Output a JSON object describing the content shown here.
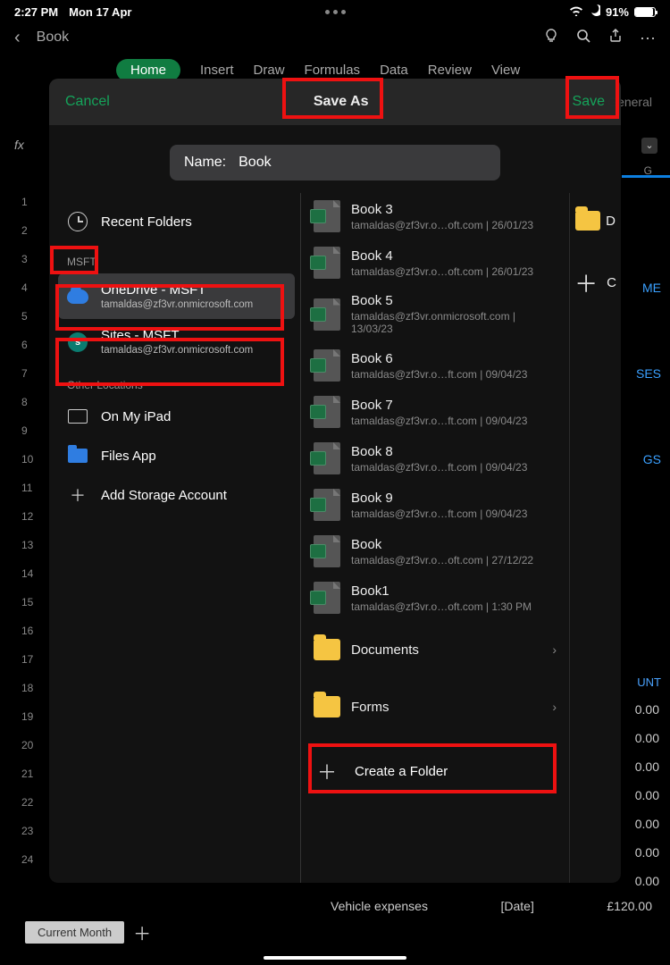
{
  "status": {
    "time": "2:27 PM",
    "date": "Mon 17 Apr",
    "battery": "91%"
  },
  "app": {
    "title": "Book"
  },
  "ribbon": {
    "tabs": [
      "Home",
      "Insert",
      "Draw",
      "Formulas",
      "Data",
      "Review",
      "View"
    ],
    "active": "Home"
  },
  "bg": {
    "general": "General",
    "fx": "fx",
    "colG": "G",
    "amount_hdr": "UNT",
    "links": {
      "reimbursable": "ME",
      "expenses": "SES",
      "filings": "GS"
    },
    "vals": [
      "0.00",
      "0.00",
      "0.00",
      "0.00",
      "0.00",
      "0.00",
      "0.00"
    ],
    "row": {
      "desc": "Vehicle expenses",
      "date": "[Date]",
      "amt": "£120.00"
    },
    "row_nums": [
      "1",
      "2",
      "3",
      "4",
      "5",
      "6",
      "7",
      "8",
      "9",
      "10",
      "11",
      "12",
      "13",
      "14",
      "15",
      "16",
      "17",
      "18",
      "19",
      "20",
      "21",
      "22",
      "23",
      "24"
    ]
  },
  "modal": {
    "cancel": "Cancel",
    "title": "Save As",
    "save": "Save",
    "name_label": "Name:",
    "name_value": "Book"
  },
  "sidebar": {
    "recent": "Recent Folders",
    "section": "MSFT",
    "onedrive": {
      "title": "OneDrive - MSFT",
      "sub": "tamaldas@zf3vr.onmicrosoft.com"
    },
    "sites": {
      "title": "Sites - MSFT",
      "sub": "tamaldas@zf3vr.onmicrosoft.com"
    },
    "other": "Other Locations",
    "ipad": "On My iPad",
    "files": "Files App",
    "add": "Add Storage Account"
  },
  "files": [
    {
      "name": "Book 3",
      "meta": "tamaldas@zf3vr.o…oft.com | 26/01/23"
    },
    {
      "name": "Book 4",
      "meta": "tamaldas@zf3vr.o…oft.com | 26/01/23"
    },
    {
      "name": "Book 5",
      "meta": "tamaldas@zf3vr.onmicrosoft.com | 13/03/23"
    },
    {
      "name": "Book 6",
      "meta": "tamaldas@zf3vr.o…ft.com | 09/04/23"
    },
    {
      "name": "Book 7",
      "meta": "tamaldas@zf3vr.o…ft.com | 09/04/23"
    },
    {
      "name": "Book 8",
      "meta": "tamaldas@zf3vr.o…ft.com | 09/04/23"
    },
    {
      "name": "Book 9",
      "meta": "tamaldas@zf3vr.o…ft.com | 09/04/23"
    },
    {
      "name": "Book",
      "meta": "tamaldas@zf3vr.o…oft.com | 27/12/22"
    },
    {
      "name": "Book1",
      "meta": "tamaldas@zf3vr.o…oft.com | 1:30 PM"
    }
  ],
  "folders": {
    "docs": "Documents",
    "forms": "Forms",
    "create": "Create a Folder"
  },
  "rightcol": {
    "D": "D",
    "C": "C"
  },
  "sheet": {
    "tab": "Current Month"
  }
}
